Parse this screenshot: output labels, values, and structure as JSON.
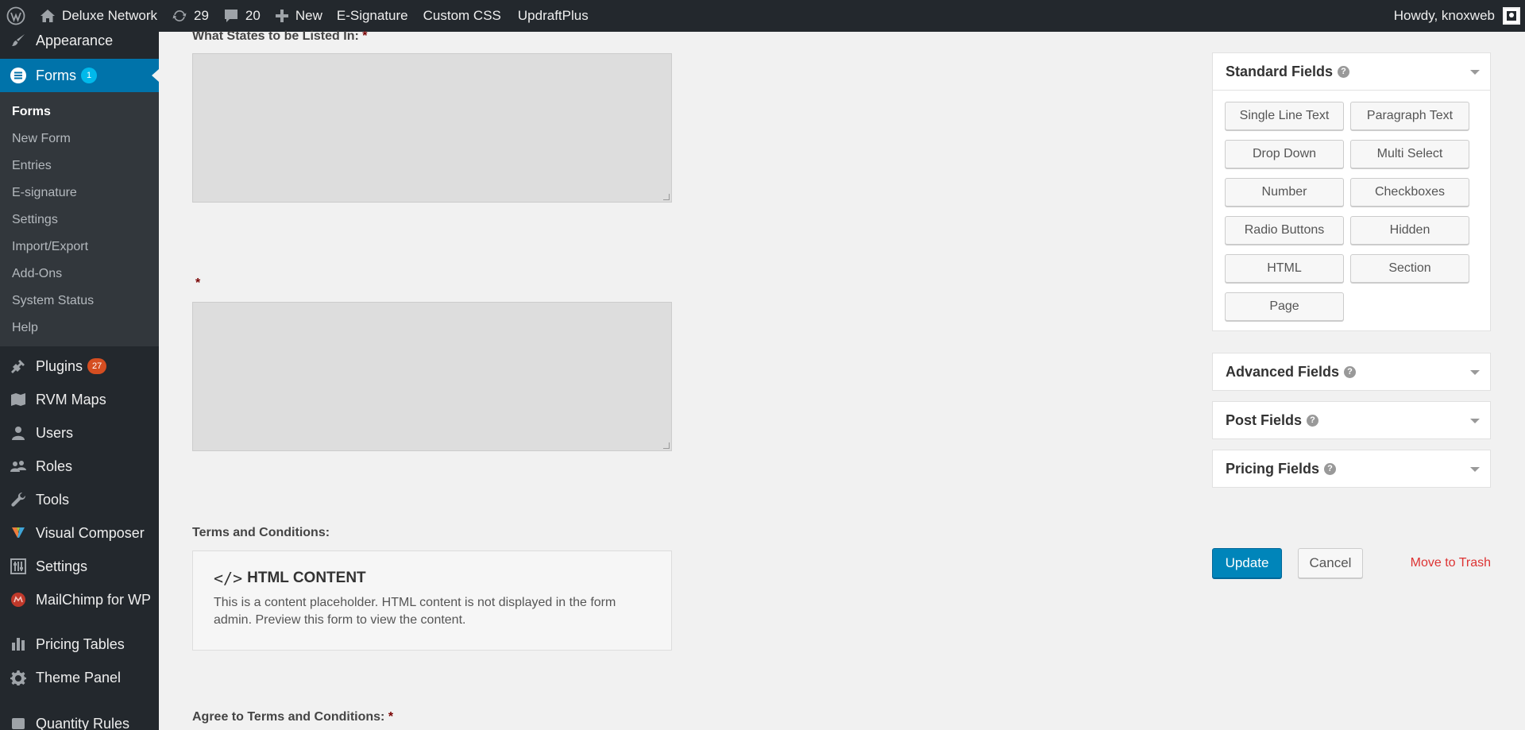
{
  "admin_bar": {
    "site_name": "Deluxe Network",
    "updates_count": "29",
    "comments_count": "20",
    "new_label": "New",
    "links": [
      "E-Signature",
      "Custom CSS",
      "UpdraftPlus"
    ],
    "greeting": "Howdy, knoxweb"
  },
  "sidebar": {
    "appearance": "Appearance",
    "forms": {
      "label": "Forms",
      "badge": "1"
    },
    "forms_submenu": [
      "Forms",
      "New Form",
      "Entries",
      "E-signature",
      "Settings",
      "Import/Export",
      "Add-Ons",
      "System Status",
      "Help"
    ],
    "plugins": {
      "label": "Plugins",
      "badge": "27"
    },
    "rvm_maps": "RVM Maps",
    "users": "Users",
    "roles": "Roles",
    "tools": "Tools",
    "visual_composer": "Visual Composer",
    "settings": "Settings",
    "mailchimp": "MailChimp for WP",
    "pricing_tables": "Pricing Tables",
    "theme_panel": "Theme Panel",
    "quantity_rules": "Quantity Rules"
  },
  "form": {
    "states_label": "What States to be Listed In:",
    "required_mark": "*",
    "terms_label": "Terms and Conditions:",
    "html_content_title": "HTML CONTENT",
    "html_content_text": "This is a content placeholder. HTML content is not displayed in the form admin. Preview this form to view the content.",
    "agree_label": "Agree to Terms and Conditions:"
  },
  "panel": {
    "standard_fields": "Standard Fields",
    "standard_buttons": [
      "Single Line Text",
      "Paragraph Text",
      "Drop Down",
      "Multi Select",
      "Number",
      "Checkboxes",
      "Radio Buttons",
      "Hidden",
      "HTML",
      "Section",
      "Page"
    ],
    "advanced_fields": "Advanced Fields",
    "post_fields": "Post Fields",
    "pricing_fields": "Pricing Fields",
    "help_mark": "?"
  },
  "actions": {
    "update": "Update",
    "cancel": "Cancel",
    "trash": "Move to Trash"
  }
}
